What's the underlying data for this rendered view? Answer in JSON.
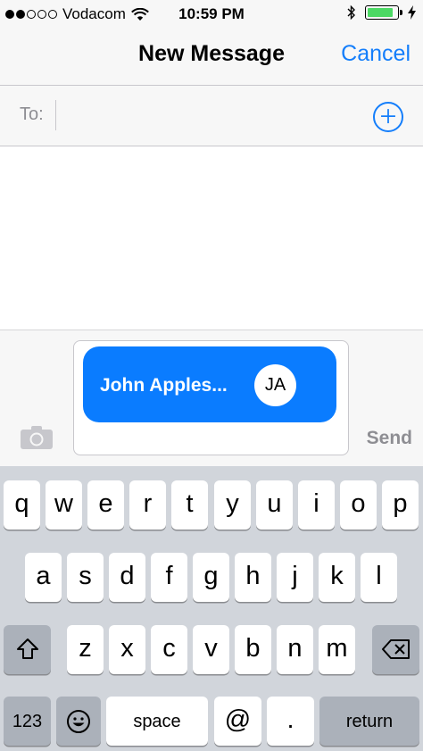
{
  "status_bar": {
    "carrier": "Vodacom",
    "time": "10:59 PM",
    "signal_bars_filled": 2,
    "signal_bars_total": 5,
    "battery_level": 0.9,
    "battery_color": "#4cd964"
  },
  "nav": {
    "title": "New Message",
    "cancel_label": "Cancel"
  },
  "to_field": {
    "label": "To:",
    "value": ""
  },
  "compose": {
    "recipient_bubble": {
      "name": "John Apples...",
      "initials": "JA"
    },
    "send_label": "Send"
  },
  "keyboard": {
    "row1": [
      "q",
      "w",
      "e",
      "r",
      "t",
      "y",
      "u",
      "i",
      "o",
      "p"
    ],
    "row2": [
      "a",
      "s",
      "d",
      "f",
      "g",
      "h",
      "j",
      "k",
      "l"
    ],
    "row3": [
      "z",
      "x",
      "c",
      "v",
      "b",
      "n",
      "m"
    ],
    "numbers_label": "123",
    "space_label": "space",
    "at_label": "@",
    "dot_label": ".",
    "return_label": "return"
  },
  "colors": {
    "accent": "#147efb",
    "bubble": "#0a7cff",
    "keyboard_bg": "#d1d5db"
  }
}
